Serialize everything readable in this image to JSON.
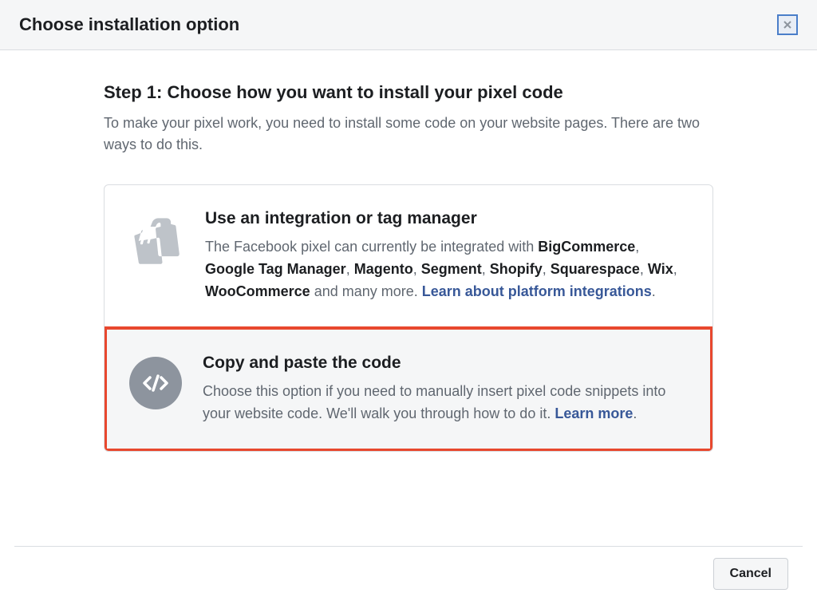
{
  "header": {
    "title": "Choose installation option"
  },
  "step": {
    "title": "Step 1: Choose how you want to install your pixel code",
    "description": "To make your pixel work, you need to install some code on your website pages. There are two ways to do this."
  },
  "options": {
    "integration": {
      "title": "Use an integration or tag manager",
      "text_lead": "The Facebook pixel can currently be integrated with ",
      "platforms": [
        "BigCommerce",
        "Google Tag Manager",
        "Magento",
        "Segment",
        "Shopify",
        "Squarespace",
        "Wix",
        "WooCommerce"
      ],
      "text_trail": " and many more. ",
      "link_text": "Learn about platform integrations"
    },
    "manual": {
      "title": "Copy and paste the code",
      "text": "Choose this option if you need to manually insert pixel code snippets into your website code. We'll walk you through how to do it. ",
      "link_text": "Learn more"
    }
  },
  "footer": {
    "cancel": "Cancel"
  }
}
